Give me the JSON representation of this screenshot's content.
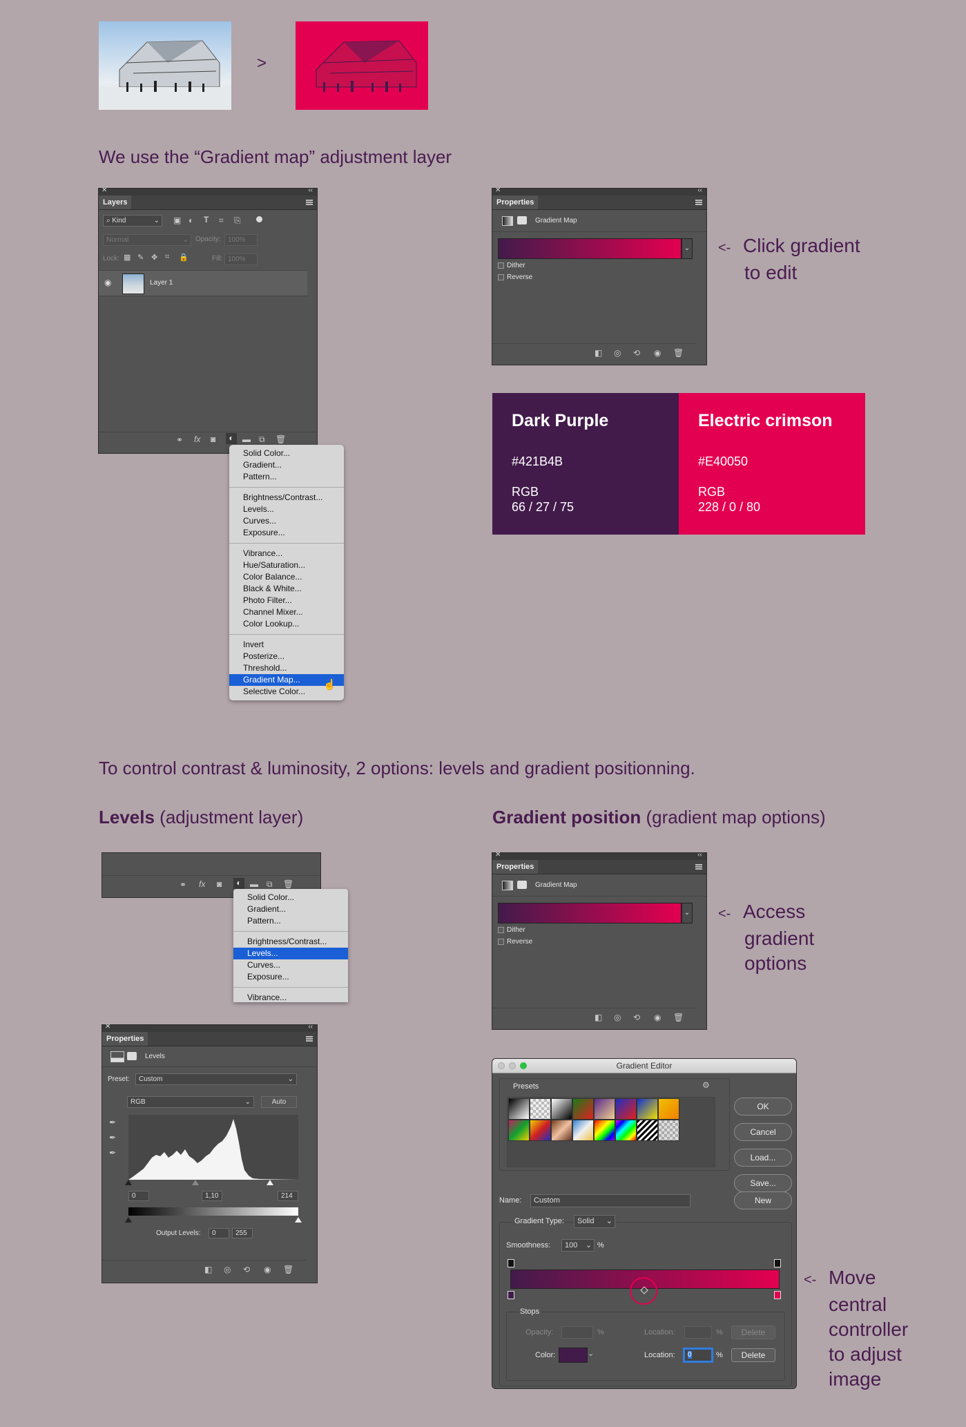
{
  "arrow_between_images": ">",
  "section1": {
    "heading": "We use the “Gradient map” adjustment layer"
  },
  "layers_panel": {
    "tab": "Layers",
    "filter_kind": "Kind",
    "blend_mode": "Normal",
    "opacity_label": "Opacity:",
    "opacity_value": "100%",
    "lock_label": "Lock:",
    "fill_label": "Fill:",
    "fill_value": "100%",
    "layer_name": "Layer 1"
  },
  "adjust_menu_full": {
    "groups": [
      [
        "Solid Color...",
        "Gradient...",
        "Pattern..."
      ],
      [
        "Brightness/Contrast...",
        "Levels...",
        "Curves...",
        "Exposure..."
      ],
      [
        "Vibrance...",
        "Hue/Saturation...",
        "Color Balance...",
        "Black & White...",
        "Photo Filter...",
        "Channel Mixer...",
        "Color Lookup..."
      ],
      [
        "Invert",
        "Posterize...",
        "Threshold...",
        "Gradient Map...",
        "Selective Color..."
      ]
    ],
    "selected": "Gradient Map..."
  },
  "properties_top": {
    "tab": "Properties",
    "title": "Gradient Map",
    "dither": "Dither",
    "reverse": "Reverse"
  },
  "note_click": {
    "arrow": "<-",
    "line1": "Click gradient",
    "line2": "to edit"
  },
  "colors": {
    "dark": {
      "name": "Dark Purple",
      "hex": "#421B4B",
      "rgb_label": "RGB",
      "rgb": "66 / 27 / 75",
      "color": "#421b4b"
    },
    "crimson": {
      "name": "Electric crimson",
      "hex": "#E40050",
      "rgb_label": "RGB",
      "rgb": "228 / 0 / 80",
      "color": "#e40050"
    }
  },
  "section2": {
    "heading": "To control contrast & luminosity, 2 options: levels and gradient positionning.",
    "levels_bold": "Levels",
    "levels_rest": " (adjustment layer)",
    "gradpos_bold": "Gradient position",
    "gradpos_rest": " (gradient map options)"
  },
  "adjust_menu_short": {
    "groups": [
      [
        "Solid Color...",
        "Gradient...",
        "Pattern..."
      ],
      [
        "Brightness/Contrast...",
        "Levels...",
        "Curves...",
        "Exposure..."
      ],
      [
        "Vibrance..."
      ]
    ],
    "selected": "Levels..."
  },
  "levels_panel": {
    "tab": "Properties",
    "title": "Levels",
    "preset_label": "Preset:",
    "preset_value": "Custom",
    "channel": "RGB",
    "auto": "Auto",
    "input_black": "0",
    "input_gamma": "1,10",
    "input_white": "214",
    "output_label": "Output Levels:",
    "output_black": "0",
    "output_white": "255"
  },
  "properties_bottom": {
    "tab": "Properties",
    "title": "Gradient Map",
    "dither": "Dither",
    "reverse": "Reverse"
  },
  "note_access": {
    "arrow": "<-",
    "lines": [
      "Access",
      "gradient",
      "options"
    ]
  },
  "gradient_editor": {
    "title": "Gradient Editor",
    "presets_label": "Presets",
    "buttons": [
      "OK",
      "Cancel",
      "Load...",
      "Save..."
    ],
    "name_label": "Name:",
    "name_value": "Custom",
    "new_button": "New",
    "type_label": "Gradient Type:",
    "type_value": "Solid",
    "smoothness_label": "Smoothness:",
    "smoothness_value": "100",
    "percent": "%",
    "stops_label": "Stops",
    "opacity_label": "Opacity:",
    "location_label": "Location:",
    "delete_label": "Delete",
    "color_label": "Color:",
    "location_value": "0"
  },
  "note_move": {
    "arrow": "<-",
    "lines": [
      "Move",
      "central",
      "controller",
      "to adjust",
      "image"
    ]
  }
}
